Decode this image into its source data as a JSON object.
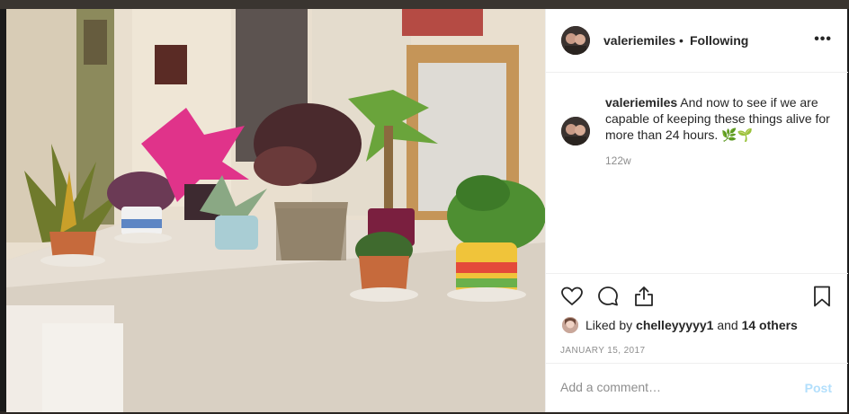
{
  "post": {
    "username": "valeriemiles",
    "separator": "•",
    "follow_status": "Following",
    "more_icon": "more-horizontal-icon",
    "caption_user": "valeriemiles",
    "caption_text": "And now to see if we are capable of keeping these things alive for more than 24 hours. 🌿🌱",
    "caption_time": "122w",
    "likes_prefix": "Liked by",
    "liked_by_user": "chelleyyyyy1",
    "likes_and": "and",
    "likes_others": "14 others",
    "date": "JANUARY 15, 2017",
    "comment_placeholder": "Add a comment…",
    "post_label": "Post"
  },
  "icons": {
    "like": "heart-icon",
    "comment": "comment-icon",
    "share": "share-icon",
    "save": "bookmark-icon"
  },
  "colors": {
    "text": "#262626",
    "muted": "#8e8e8e",
    "post_disabled": "#b2dffc",
    "divider": "#efefef"
  }
}
